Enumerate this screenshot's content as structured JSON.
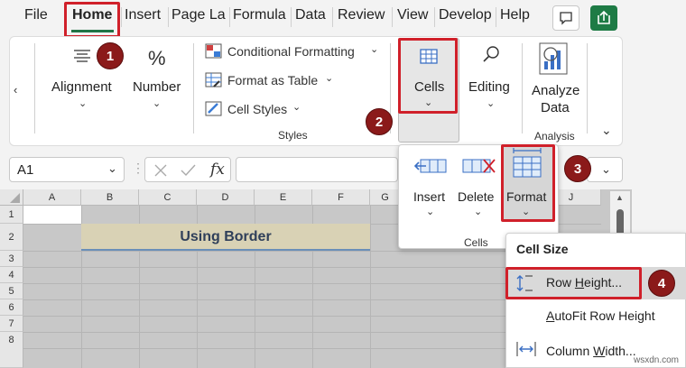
{
  "menu": {
    "tabs": [
      "File",
      "Home",
      "Insert",
      "Page La",
      "Formula",
      "Data",
      "Review",
      "View",
      "Develop",
      "Help"
    ],
    "active_tab": "Home"
  },
  "markers": [
    "1",
    "2",
    "3",
    "4"
  ],
  "ribbon": {
    "alignment_label": "Alignment",
    "number_label": "Number",
    "conditional_formatting": "Conditional Formatting",
    "format_as_table": "Format as Table",
    "cell_styles": "Cell Styles",
    "styles_group": "Styles",
    "cells_label": "Cells",
    "editing_label": "Editing",
    "analyze_data_line1": "Analyze",
    "analyze_data_line2": "Data",
    "analysis_group": "Analysis"
  },
  "formula_bar": {
    "name_box": "A1",
    "fx": "fx"
  },
  "cells_dropdown": {
    "insert": "Insert",
    "delete": "Delete",
    "format": "Format",
    "group_label": "Cells"
  },
  "grid": {
    "columns": [
      "A",
      "B",
      "C",
      "D",
      "E",
      "F",
      "G",
      "J"
    ],
    "rows": [
      "1",
      "2",
      "3",
      "4",
      "5",
      "6",
      "7",
      "8"
    ],
    "title_cell": "Using Border"
  },
  "format_menu": {
    "header": "Cell Size",
    "row_height_pre": "Row ",
    "row_height_u": "H",
    "row_height_post": "eight...",
    "autofit_u": "A",
    "autofit_post": "utoFit Row Height",
    "column_width_pre": "Column ",
    "column_width_u": "W",
    "column_width_post": "idth..."
  },
  "watermark": "wsxdn.com",
  "colors": {
    "accent": "#217346",
    "highlight": "#d0202a",
    "marker": "#8b1a1a",
    "title_fill": "#d9d2b5"
  }
}
